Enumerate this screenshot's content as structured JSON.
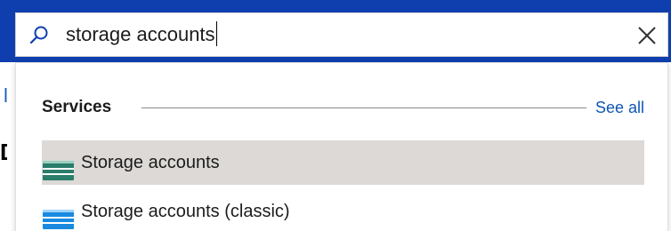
{
  "search": {
    "value": "storage accounts",
    "icon": "search-icon",
    "clear_icon": "close-icon"
  },
  "background": {
    "glyph_1": "l",
    "glyph_2": "D"
  },
  "dropdown": {
    "section_title": "Services",
    "see_all_label": "See all",
    "results": [
      {
        "label": "Storage accounts",
        "icon": "storage-account-icon",
        "selected": true
      },
      {
        "label": "Storage accounts (classic)",
        "icon": "storage-account-classic-icon",
        "selected": false
      }
    ]
  },
  "colors": {
    "header_blue": "#0f3fae",
    "link_blue": "#0f56b3",
    "selected_row": "#dcd9d6",
    "storage_green": "#2a7d6a",
    "storage_blue": "#1a8ae0"
  }
}
